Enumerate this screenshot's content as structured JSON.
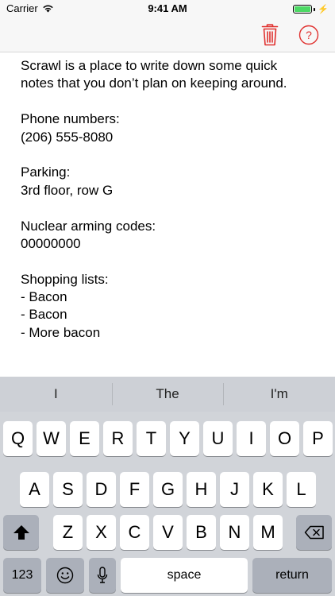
{
  "status_bar": {
    "carrier": "Carrier",
    "time": "9:41 AM"
  },
  "nav_bar": {
    "tint_color": "#e0302e",
    "trash_icon": "trash-icon",
    "help_icon": "question-circle-icon"
  },
  "note": {
    "lines": [
      "Scrawl is a place to write down some quick",
      "notes that you don’t plan on keeping around.",
      "",
      "Phone numbers:",
      "(206) 555-8080",
      "",
      "Parking:",
      "3rd floor, row G",
      "",
      "Nuclear arming codes:",
      "00000000",
      "",
      "Shopping lists:",
      "- Bacon",
      "- Bacon",
      "- More bacon"
    ]
  },
  "keyboard": {
    "suggestions": [
      "I",
      "The",
      "I'm"
    ],
    "row1": [
      "Q",
      "W",
      "E",
      "R",
      "T",
      "Y",
      "U",
      "I",
      "O",
      "P"
    ],
    "row2": [
      "A",
      "S",
      "D",
      "F",
      "G",
      "H",
      "J",
      "K",
      "L"
    ],
    "row3": [
      "Z",
      "X",
      "C",
      "V",
      "B",
      "N",
      "M"
    ],
    "numbers_label": "123",
    "space_label": "space",
    "return_label": "return",
    "shift_icon": "shift-icon",
    "delete_icon": "backspace-icon",
    "emoji_icon": "emoji-icon",
    "mic_icon": "microphone-icon"
  }
}
